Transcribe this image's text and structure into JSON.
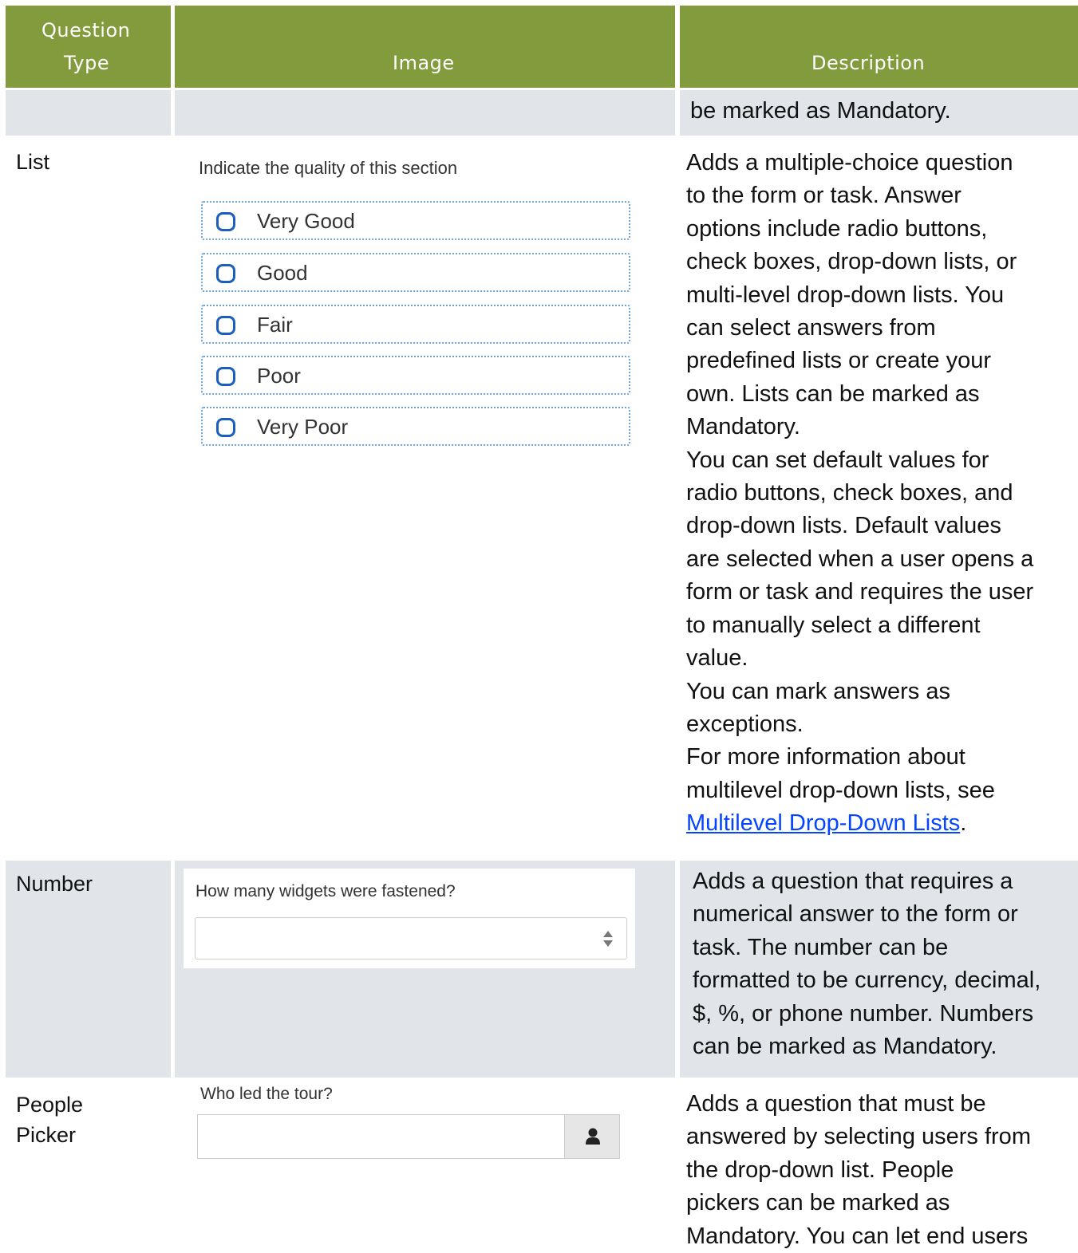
{
  "header": {
    "col_type": "Question Type",
    "col_type_line1": "Question",
    "col_type_line2": "Type",
    "col_image": "Image",
    "col_description": "Description"
  },
  "row_prev": {
    "description": "be marked as Mandatory."
  },
  "row_list": {
    "type": "List",
    "question": "Indicate the quality of this section",
    "options": [
      "Very Good",
      "Good",
      "Fair",
      "Poor",
      "Very Poor"
    ],
    "description_lines": [
      "Adds a multiple-choice question",
      "to the form or task. Answer",
      "options include radio buttons,",
      "check boxes, drop-down lists, or",
      "multi-level drop-down lists. You",
      "can select answers from",
      "predefined lists or create your",
      "own. Lists can be marked as",
      "Mandatory.",
      "You can set default values for",
      "radio buttons, check boxes, and",
      "drop-down lists. Default values",
      "are selected when a user opens a",
      "form or task and requires the user",
      "to manually select a different",
      "value.",
      "You can mark answers as",
      "exceptions.",
      "For more information about",
      "multilevel drop-down lists, see"
    ],
    "link_text": "Multilevel Drop-Down Lists",
    "link_suffix": "."
  },
  "row_number": {
    "type": "Number",
    "question": "How many widgets were fastened?",
    "description_lines": [
      "Adds a question that requires a",
      "numerical answer to the form or",
      "task. The number can be",
      "formatted to be currency, decimal,",
      "$, %, or phone number. Numbers",
      "can be marked as Mandatory."
    ]
  },
  "row_people": {
    "type_line1": "People",
    "type_line2": "Picker",
    "question": "Who led the tour?",
    "button_icon": "person-icon",
    "description_lines": [
      "Adds a question that must be",
      "answered by selecting users from",
      "the drop-down list. People",
      "pickers can be marked as",
      "Mandatory. You can let end users"
    ]
  },
  "colors": {
    "header_bg": "#819b3d",
    "row_grey": "#e1e5e9",
    "radio_border": "#1a5fbf",
    "link": "#0645ff"
  }
}
